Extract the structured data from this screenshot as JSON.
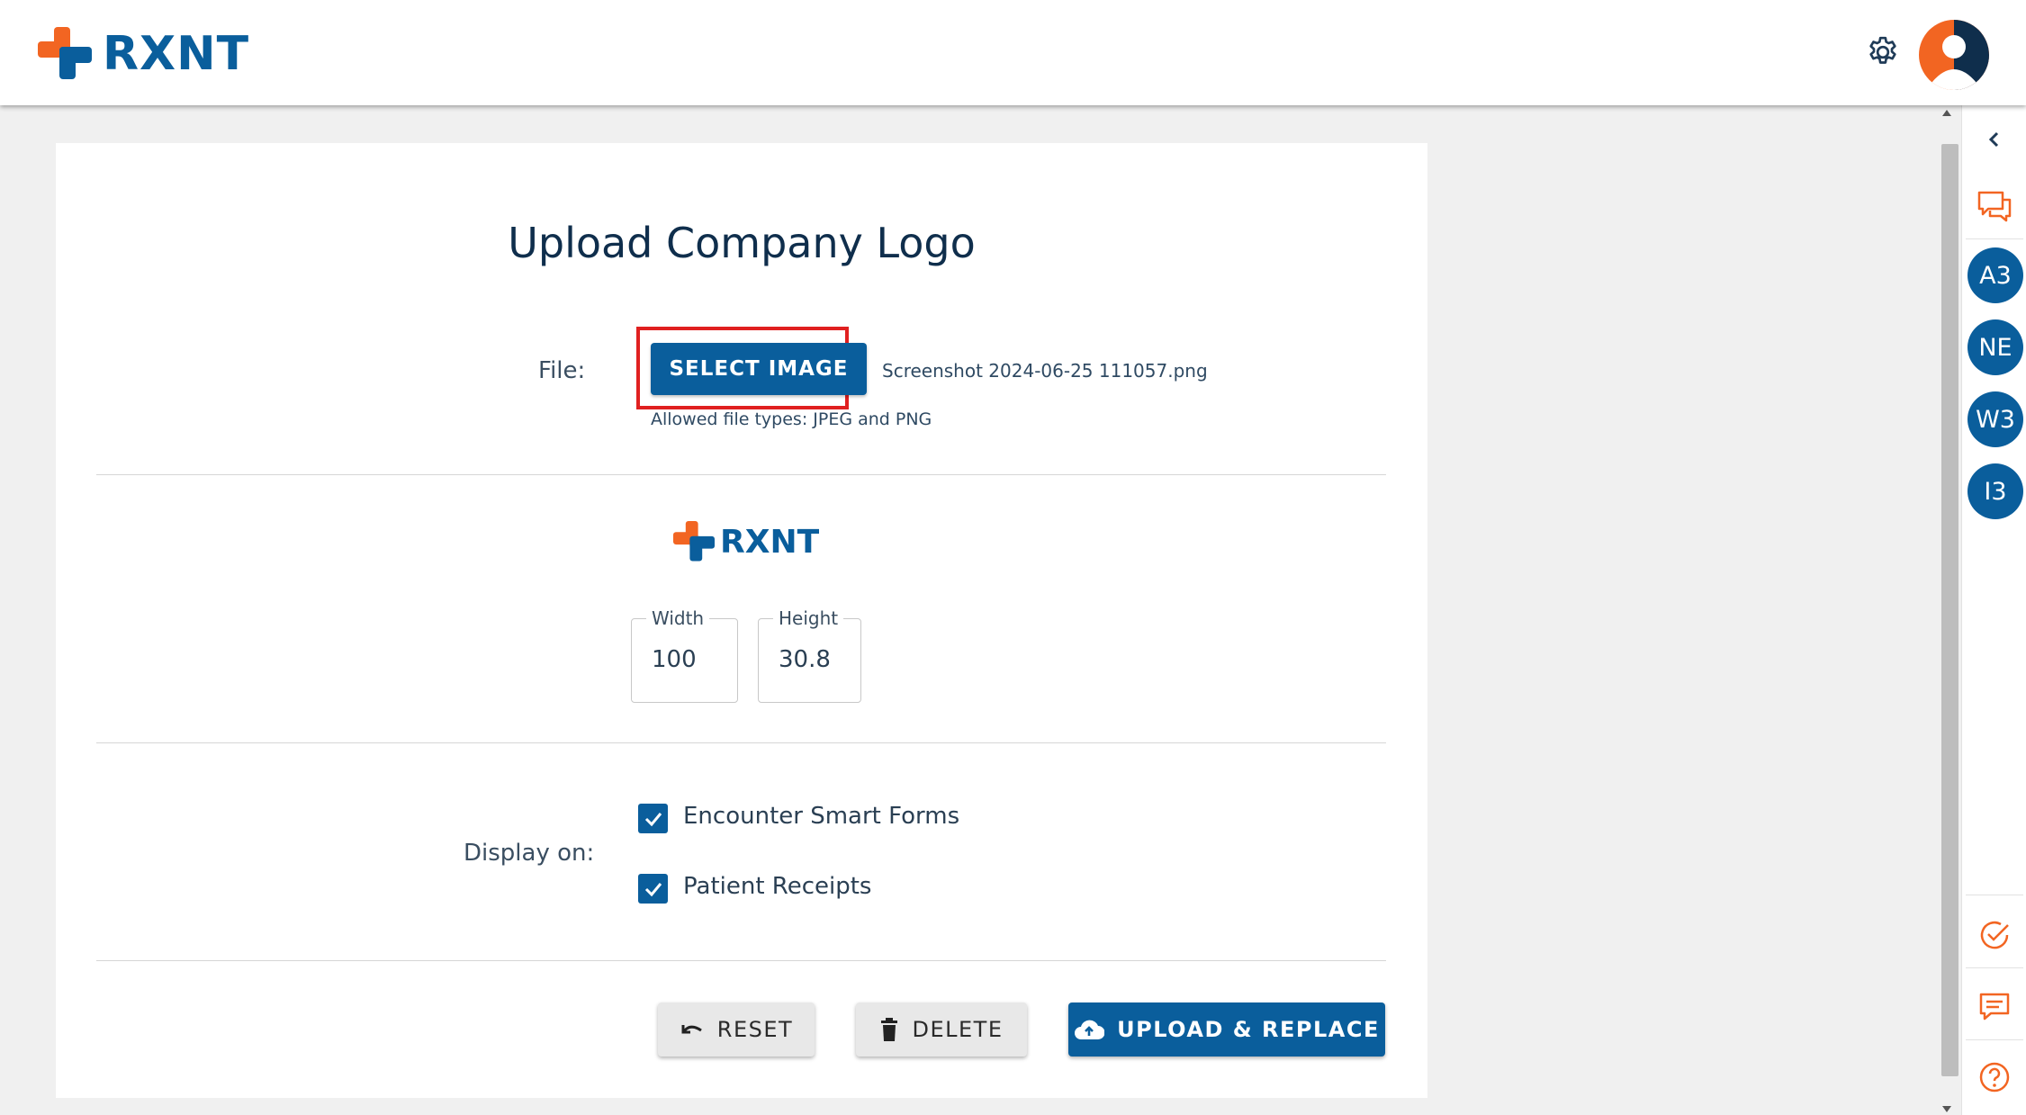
{
  "header": {
    "brand": "RXNT",
    "colors": {
      "brand_blue": "#0a5e9c",
      "brand_orange": "#f26522"
    }
  },
  "rightbar": {
    "badges": [
      "A3",
      "NE",
      "W3",
      "I3"
    ]
  },
  "form": {
    "title": "Upload Company Logo",
    "file_label": "File:",
    "select_button": "SELECT IMAGE",
    "file_name": "Screenshot 2024-06-25 111057.png",
    "allowed_types": "Allowed file types: JPEG and PNG",
    "preview_brand": "RXNT",
    "width_label": "Width",
    "width_value": "100",
    "height_label": "Height",
    "height_value": "30.8",
    "display_label": "Display on:",
    "options": [
      {
        "label": "Encounter Smart Forms",
        "checked": true
      },
      {
        "label": "Patient Receipts",
        "checked": true
      }
    ],
    "reset_button": "RESET",
    "delete_button": "DELETE",
    "upload_button": "UPLOAD & REPLACE"
  }
}
